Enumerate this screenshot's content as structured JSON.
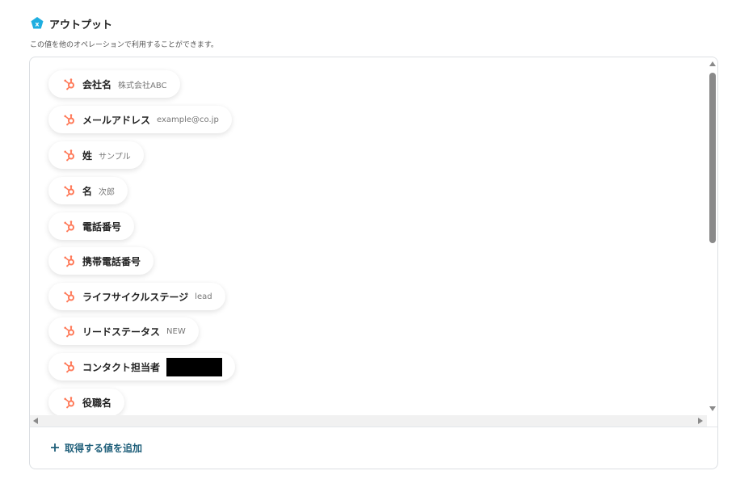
{
  "header": {
    "title": "アウトプット",
    "subtitle": "この値を他のオペレーションで利用することができます。",
    "logo_icon": "yoom-logo-icon"
  },
  "colors": {
    "hubspot_orange": "#ff7a59",
    "logo_cyan": "#1eaee0",
    "add_text": "#1f5f7a"
  },
  "fields": [
    {
      "label": "会社名",
      "value": "株式会社ABC",
      "redacted": false
    },
    {
      "label": "メールアドレス",
      "value": "example@co.jp",
      "redacted": false
    },
    {
      "label": "姓",
      "value": "サンプル",
      "redacted": false
    },
    {
      "label": "名",
      "value": "次郎",
      "redacted": false
    },
    {
      "label": "電話番号",
      "value": "",
      "redacted": false
    },
    {
      "label": "携帯電話番号",
      "value": "",
      "redacted": false
    },
    {
      "label": "ライフサイクルステージ",
      "value": "lead",
      "redacted": false
    },
    {
      "label": "リードステータス",
      "value": "NEW",
      "redacted": false
    },
    {
      "label": "コンタクト担当者",
      "value": "",
      "redacted": true
    },
    {
      "label": "役職名",
      "value": "",
      "redacted": false
    }
  ],
  "field_icon": "hubspot-icon",
  "add_button": {
    "label": "取得する値を追加",
    "icon": "plus-icon"
  }
}
